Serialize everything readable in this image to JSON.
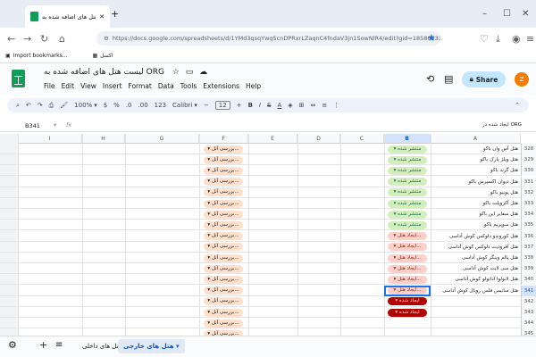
{
  "browser": {
    "tab_title": "لیست هتل های اضافه شده به O",
    "url": "https://docs.google.com/spreadsheets/d/1YMd3qsqYwq5cnDPRxrLZaqnC4fndaV3jn1SowNlR4/edit?gid=1858653394#gid=1858",
    "bookmarks": [
      "Import bookmarks...",
      "اکسل"
    ]
  },
  "app": {
    "title": "لیست هتل های اضافه شده به ORG",
    "menus": [
      "File",
      "Edit",
      "View",
      "Insert",
      "Format",
      "Data",
      "Tools",
      "Extensions",
      "Help"
    ],
    "share_label": "Share",
    "avatar_letter": "Z"
  },
  "toolbar": {
    "zoom": "100%",
    "currency": "$",
    "percent": "%",
    "decimals": ".0",
    "decimals2": ".00",
    "format123": "123",
    "font": "Calibri",
    "font_size": "12",
    "bold": "B",
    "italic": "I",
    "strike": "S",
    "textcolor": "A"
  },
  "formula_bar": {
    "cell_ref": "B341",
    "fx": "fx",
    "right_text": "ایجاد شده در ORG"
  },
  "columns": [
    "I",
    "H",
    "G",
    "F",
    "E",
    "D",
    "C",
    "B",
    "A"
  ],
  "rows": [
    {
      "num": "328",
      "name": "هتل آس وان باکو",
      "status": "منتشر شده",
      "statusType": "published",
      "f": "بررسی آنل..."
    },
    {
      "num": "329",
      "name": "هتل ویلژ پارک باکو",
      "status": "منتشر شده",
      "statusType": "published",
      "f": "بررسی آنل..."
    },
    {
      "num": "330",
      "name": "هتل گرند باکو",
      "status": "منتشر شده",
      "statusType": "published",
      "f": "بررسی آنل..."
    },
    {
      "num": "331",
      "name": "هتل دیوان اکسپرس باکو",
      "status": "منتشر شده",
      "statusType": "published",
      "f": "بررسی آنل..."
    },
    {
      "num": "332",
      "name": "هتل یونیو باکو",
      "status": "منتشر شده",
      "statusType": "published",
      "f": "بررسی آنل..."
    },
    {
      "num": "333",
      "name": "هتل آکروپلت باکو",
      "status": "منتشر شده",
      "statusType": "published",
      "f": "بررسی آنل..."
    },
    {
      "num": "334",
      "name": "هتل سفایر این باکو",
      "status": "منتشر شده",
      "statusType": "published",
      "f": "بررسی آنل..."
    },
    {
      "num": "335",
      "name": "هتل سوپریم باکو",
      "status": "منتشر شده",
      "statusType": "published",
      "f": "بررسی آنل..."
    },
    {
      "num": "336",
      "name": "هتل کوروندو دلوکس کوش آداسی",
      "status": "ایجاد هتل...",
      "statusType": "requested",
      "f": "بررسی آنل..."
    },
    {
      "num": "337",
      "name": "هتل آفرودیت دلوکس کوش آداسی",
      "status": "ایجاد هتل...",
      "statusType": "requested",
      "f": "بررسی آنل..."
    },
    {
      "num": "338",
      "name": "هتل پالم وینگز کوش آداسی",
      "status": "ایجاد هتل...",
      "statusType": "requested",
      "f": "بررسی آنل..."
    },
    {
      "num": "339",
      "name": "هتل سی لایت کوش آداسی",
      "status": "ایجاد هتل...",
      "statusType": "requested",
      "f": "بررسی آنل..."
    },
    {
      "num": "340",
      "name": "هتل لانولوا آدانولو کوش آداسی",
      "status": "ایجاد هتل...",
      "statusType": "requested",
      "f": "بررسی آنل..."
    },
    {
      "num": "341",
      "name": "هتل سانیس فلس رویال کوش آداسی",
      "status": "ایجاد هتل...",
      "statusType": "requested",
      "f": "بررسی آنل..."
    },
    {
      "num": "342",
      "name": "",
      "status": "ایجاد شده",
      "statusType": "created",
      "f": "بررسی آنل..."
    },
    {
      "num": "343",
      "name": "",
      "status": "ایجاد شده",
      "statusType": "created",
      "f": "بررسی آنل..."
    },
    {
      "num": "344",
      "name": "",
      "status": "",
      "statusType": "",
      "f": "بررسی آنل..."
    },
    {
      "num": "345",
      "name": "",
      "status": "",
      "statusType": "",
      "f": "بررسی آنل..."
    }
  ],
  "sheets": [
    {
      "label": "هتل های خارجی",
      "active": true
    },
    {
      "label": "هتل های داخلی",
      "active": false
    }
  ]
}
